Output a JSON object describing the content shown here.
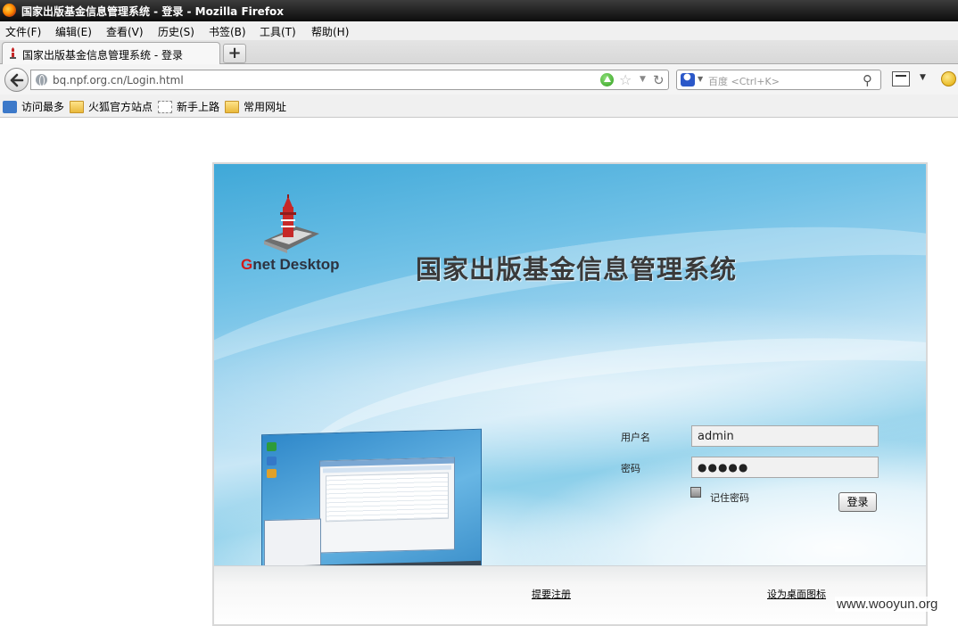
{
  "window": {
    "title": "国家出版基金信息管理系统 - 登录 - Mozilla Firefox"
  },
  "menu": {
    "items": [
      "文件(F)",
      "编辑(E)",
      "查看(V)",
      "历史(S)",
      "书签(B)",
      "工具(T)",
      "帮助(H)"
    ]
  },
  "tab": {
    "label": "国家出版基金信息管理系统 - 登录",
    "new_tab_label": "+"
  },
  "nav": {
    "url": "bq.npf.org.cn/Login.html",
    "search_placeholder": "百度 <Ctrl+K>"
  },
  "bookmarks": {
    "items": [
      {
        "label": "访问最多",
        "icon": "magnifier-icon"
      },
      {
        "label": "火狐官方站点",
        "icon": "folder-icon"
      },
      {
        "label": "新手上路",
        "icon": "page-icon"
      },
      {
        "label": "常用网址",
        "icon": "folder-icon"
      }
    ]
  },
  "page": {
    "brand_g": "G",
    "brand_rest": "net Desktop",
    "system_title": "国家出版基金信息管理系统",
    "form": {
      "username_label": "用户名",
      "username_value": "admin",
      "password_label": "密码",
      "password_value": "●●●●●",
      "remember_label": "记住密码",
      "login_button": "登录"
    },
    "links": {
      "register": "提要注册",
      "desktop_icon": "设为桌面图标"
    }
  },
  "watermark": "www.wooyun.org",
  "colors": {
    "title_bar": "#1c1c1c",
    "accent_blue": "#3fa8d8",
    "brand_red": "#d11b1b"
  }
}
